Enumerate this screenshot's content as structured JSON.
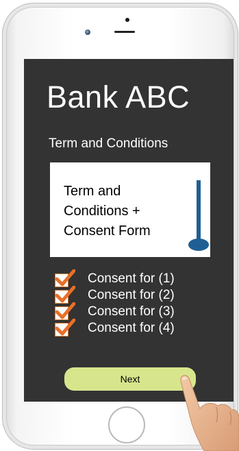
{
  "app": {
    "title": "Bank ABC"
  },
  "page": {
    "subtitle": "Term and Conditions"
  },
  "terms_box": {
    "text_line1": "Term and",
    "text_line2": "Conditions +",
    "text_line3": "Consent Form"
  },
  "consents": [
    {
      "label": "Consent for (1)",
      "checked": true
    },
    {
      "label": "Consent for (2)",
      "checked": true
    },
    {
      "label": "Consent for (3)",
      "checked": true
    },
    {
      "label": "Consent for (4)",
      "checked": true
    }
  ],
  "actions": {
    "next_label": "Next"
  },
  "colors": {
    "screen_bg": "#333333",
    "accent_button": "#d7e68c",
    "checkmark": "#e8702a",
    "scrollbar": "#1f5f94"
  },
  "icons": {
    "checkbox": "checkmark-icon",
    "scroll": "scrollbar-icon",
    "pointer": "hand-pointer-icon"
  }
}
